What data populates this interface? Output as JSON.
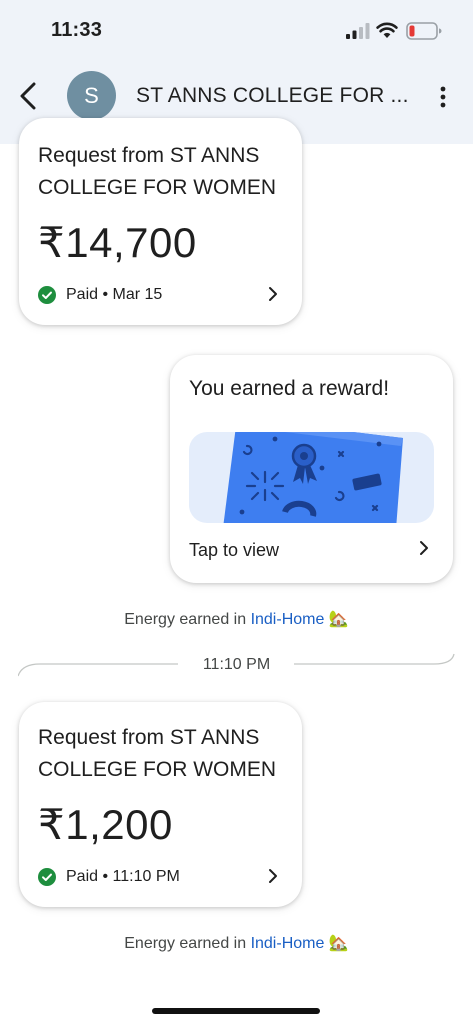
{
  "status_bar": {
    "time": "11:33"
  },
  "header": {
    "avatar_letter": "S",
    "title": "ST ANNS COLLEGE FOR ..."
  },
  "messages": {
    "req1": {
      "title": "Request from ST ANNS COLLEGE FOR WOMEN",
      "amount": "₹14,700",
      "status": "Paid • Mar 15"
    },
    "reward": {
      "title": "You earned a reward!",
      "action": "Tap to view"
    },
    "energy1": {
      "prefix": "Energy earned in ",
      "link": "Indi-Home",
      "emoji": "🏡"
    },
    "time_divider": "11:10 PM",
    "req2": {
      "title": "Request from ST ANNS COLLEGE FOR WOMEN",
      "amount": "₹1,200",
      "status": "Paid • 11:10 PM"
    },
    "energy2": {
      "prefix": "Energy earned in ",
      "link": "Indi-Home",
      "emoji": "🏡"
    }
  },
  "colors": {
    "header_bg": "#eff3f9",
    "paid_green": "#1e8e3e",
    "link_blue": "#1a5fc4",
    "reward_card_blue": "#3e7ef0",
    "avatar_bg": "#6f8fa1"
  },
  "icons": {
    "back": "arrow-back-icon",
    "menu": "more-vert-icon",
    "paid": "check-circle-icon",
    "chevron": "chevron-right-icon"
  }
}
